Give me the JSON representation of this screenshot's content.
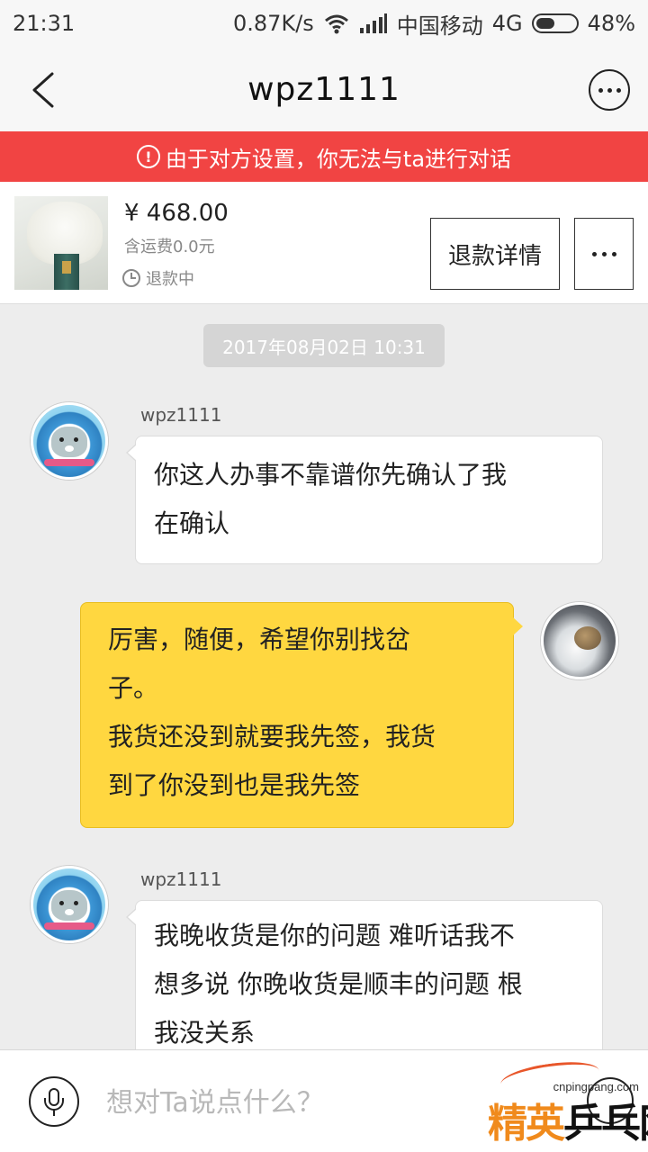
{
  "status_bar": {
    "time": "21:31",
    "net_speed": "0.87K/s",
    "carrier": "中国移动",
    "network": "4G",
    "battery": "48%",
    "battery_level": 0.48
  },
  "header": {
    "title": "wpz1111"
  },
  "alert": {
    "text": "由于对方设置，你无法与ta进行对话"
  },
  "order": {
    "price": "¥ 468.00",
    "shipping": "含运费0.0元",
    "status": "退款中",
    "refund_button": "退款详情"
  },
  "chat": {
    "timestamp": "2017年08月02日 10:31",
    "messages": [
      {
        "sender": "wpz1111",
        "direction": "in",
        "lines": [
          "你这人办事不靠谱你先确认了我",
          "在确认"
        ]
      },
      {
        "sender": "",
        "direction": "out",
        "lines": [
          "厉害，随便，希望你别找岔",
          "子。",
          "我货还没到就要我先签，我货",
          "到了你没到也是我先签"
        ]
      },
      {
        "sender": "wpz1111",
        "direction": "in",
        "lines": [
          "我晚收货是你的问题 难听话我不",
          "想多说 你晚收货是顺丰的问题 根",
          "我没关系"
        ]
      }
    ]
  },
  "input": {
    "placeholder": "想对Ta说点什么？"
  },
  "watermark": {
    "url": "cnpingpang.com",
    "text_part1": "精英",
    "text_part2": "乒乓网"
  },
  "colors": {
    "alert_red": "#f14443",
    "bubble_yellow": "#ffd740",
    "background": "#ededed"
  },
  "icons": [
    "back-arrow-icon",
    "more-icon",
    "alert-icon",
    "clock-icon",
    "mic-icon",
    "wifi-icon",
    "signal-icon",
    "battery-icon"
  ]
}
